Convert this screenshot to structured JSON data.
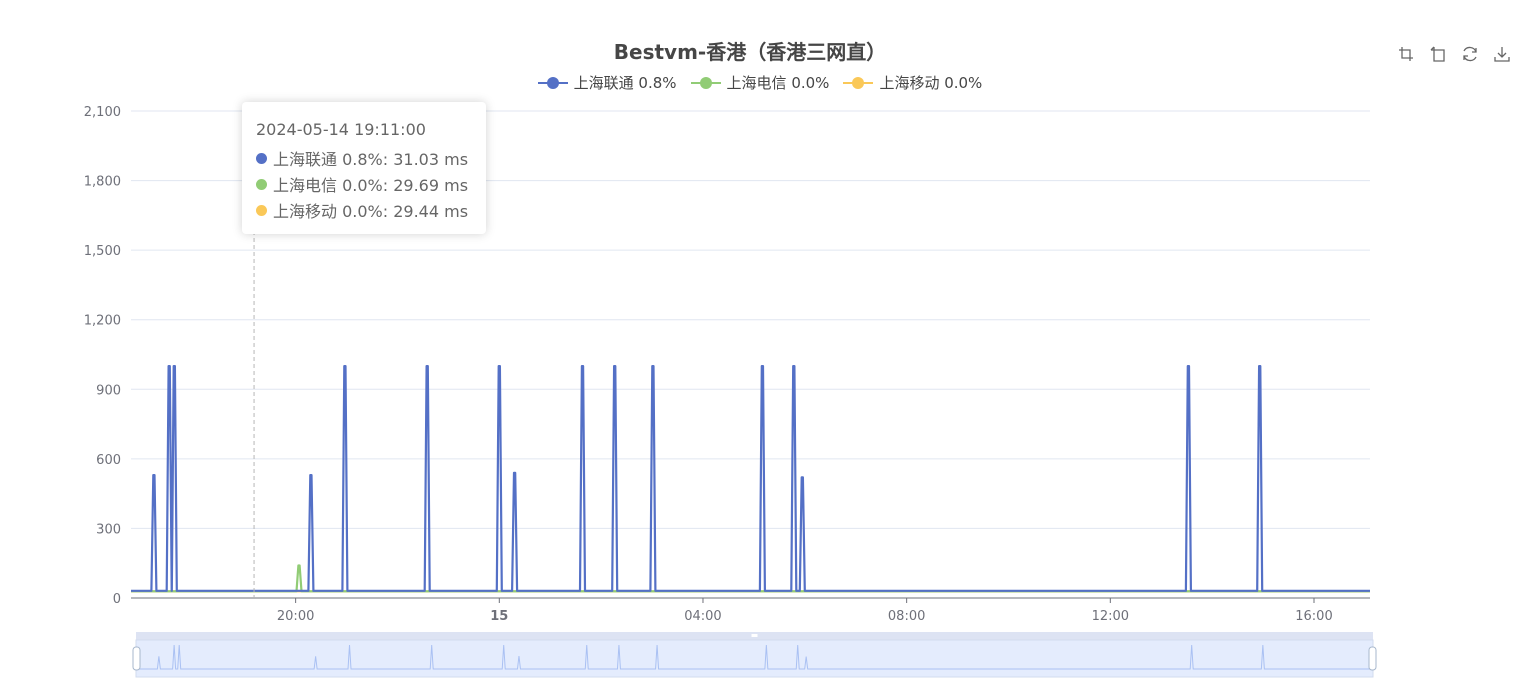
{
  "chart_data": {
    "type": "line",
    "title": "Bestvm-香港（香港三网直）",
    "ylim": [
      0,
      2100
    ],
    "yticks": [
      0,
      300,
      600,
      900,
      1200,
      1500,
      1800
    ],
    "ytick_labels": [
      "0",
      "300",
      "600",
      "900",
      "1,200",
      "1,500",
      "1,800",
      "2,100"
    ],
    "xrange_hours": [
      "2024-05-14 16:46",
      "2024-05-15 17:06"
    ],
    "xtick_labels": [
      {
        "label": "20:00",
        "time": "2024-05-14 20:00",
        "bold": false
      },
      {
        "label": "15",
        "time": "2024-05-15 00:00",
        "bold": true
      },
      {
        "label": "04:00",
        "time": "2024-05-15 04:00",
        "bold": false
      },
      {
        "label": "08:00",
        "time": "2024-05-15 08:00",
        "bold": false
      },
      {
        "label": "12:00",
        "time": "2024-05-15 12:00",
        "bold": false
      },
      {
        "label": "16:00",
        "time": "2024-05-15 16:00",
        "bold": false
      }
    ],
    "legend_position": "top-center",
    "grid": true,
    "series": [
      {
        "name": "上海联通 0.8%",
        "color": "#5470c6",
        "baseline": 31,
        "spikes": [
          {
            "time": "2024-05-14 17:13",
            "value": 530
          },
          {
            "time": "2024-05-14 17:31",
            "value": 1000
          },
          {
            "time": "2024-05-14 17:37",
            "value": 1000
          },
          {
            "time": "2024-05-14 20:18",
            "value": 530
          },
          {
            "time": "2024-05-14 20:58",
            "value": 1000
          },
          {
            "time": "2024-05-14 22:35",
            "value": 1000
          },
          {
            "time": "2024-05-15 00:00",
            "value": 1000
          },
          {
            "time": "2024-05-15 00:18",
            "value": 540
          },
          {
            "time": "2024-05-15 01:38",
            "value": 1000
          },
          {
            "time": "2024-05-15 02:16",
            "value": 1000
          },
          {
            "time": "2024-05-15 03:01",
            "value": 1000
          },
          {
            "time": "2024-05-15 05:10",
            "value": 1000
          },
          {
            "time": "2024-05-15 05:47",
            "value": 1000
          },
          {
            "time": "2024-05-15 05:57",
            "value": 520
          },
          {
            "time": "2024-05-15 13:32",
            "value": 1000
          },
          {
            "time": "2024-05-15 14:56",
            "value": 1000
          }
        ]
      },
      {
        "name": "上海电信 0.0%",
        "color": "#91cc75",
        "baseline": 29,
        "spikes": [
          {
            "time": "2024-05-14 20:04",
            "value": 140
          }
        ]
      },
      {
        "name": "上海移动 0.0%",
        "color": "#fac858",
        "baseline": 29,
        "spikes": []
      }
    ],
    "tooltip": {
      "time": "2024-05-14 19:11:00",
      "rows": [
        {
          "label": "上海联通 0.8%: 31.03 ms",
          "color": "#5470c6"
        },
        {
          "label": "上海电信 0.0%: 29.69 ms",
          "color": "#91cc75"
        },
        {
          "label": "上海移动 0.0%: 29.44 ms",
          "color": "#fac858"
        }
      ]
    },
    "datazoom": {
      "start": 0,
      "end": 100
    }
  },
  "toolbox": [
    "zoom-icon",
    "zoom-reset-icon",
    "restore-icon",
    "save-image-icon"
  ]
}
